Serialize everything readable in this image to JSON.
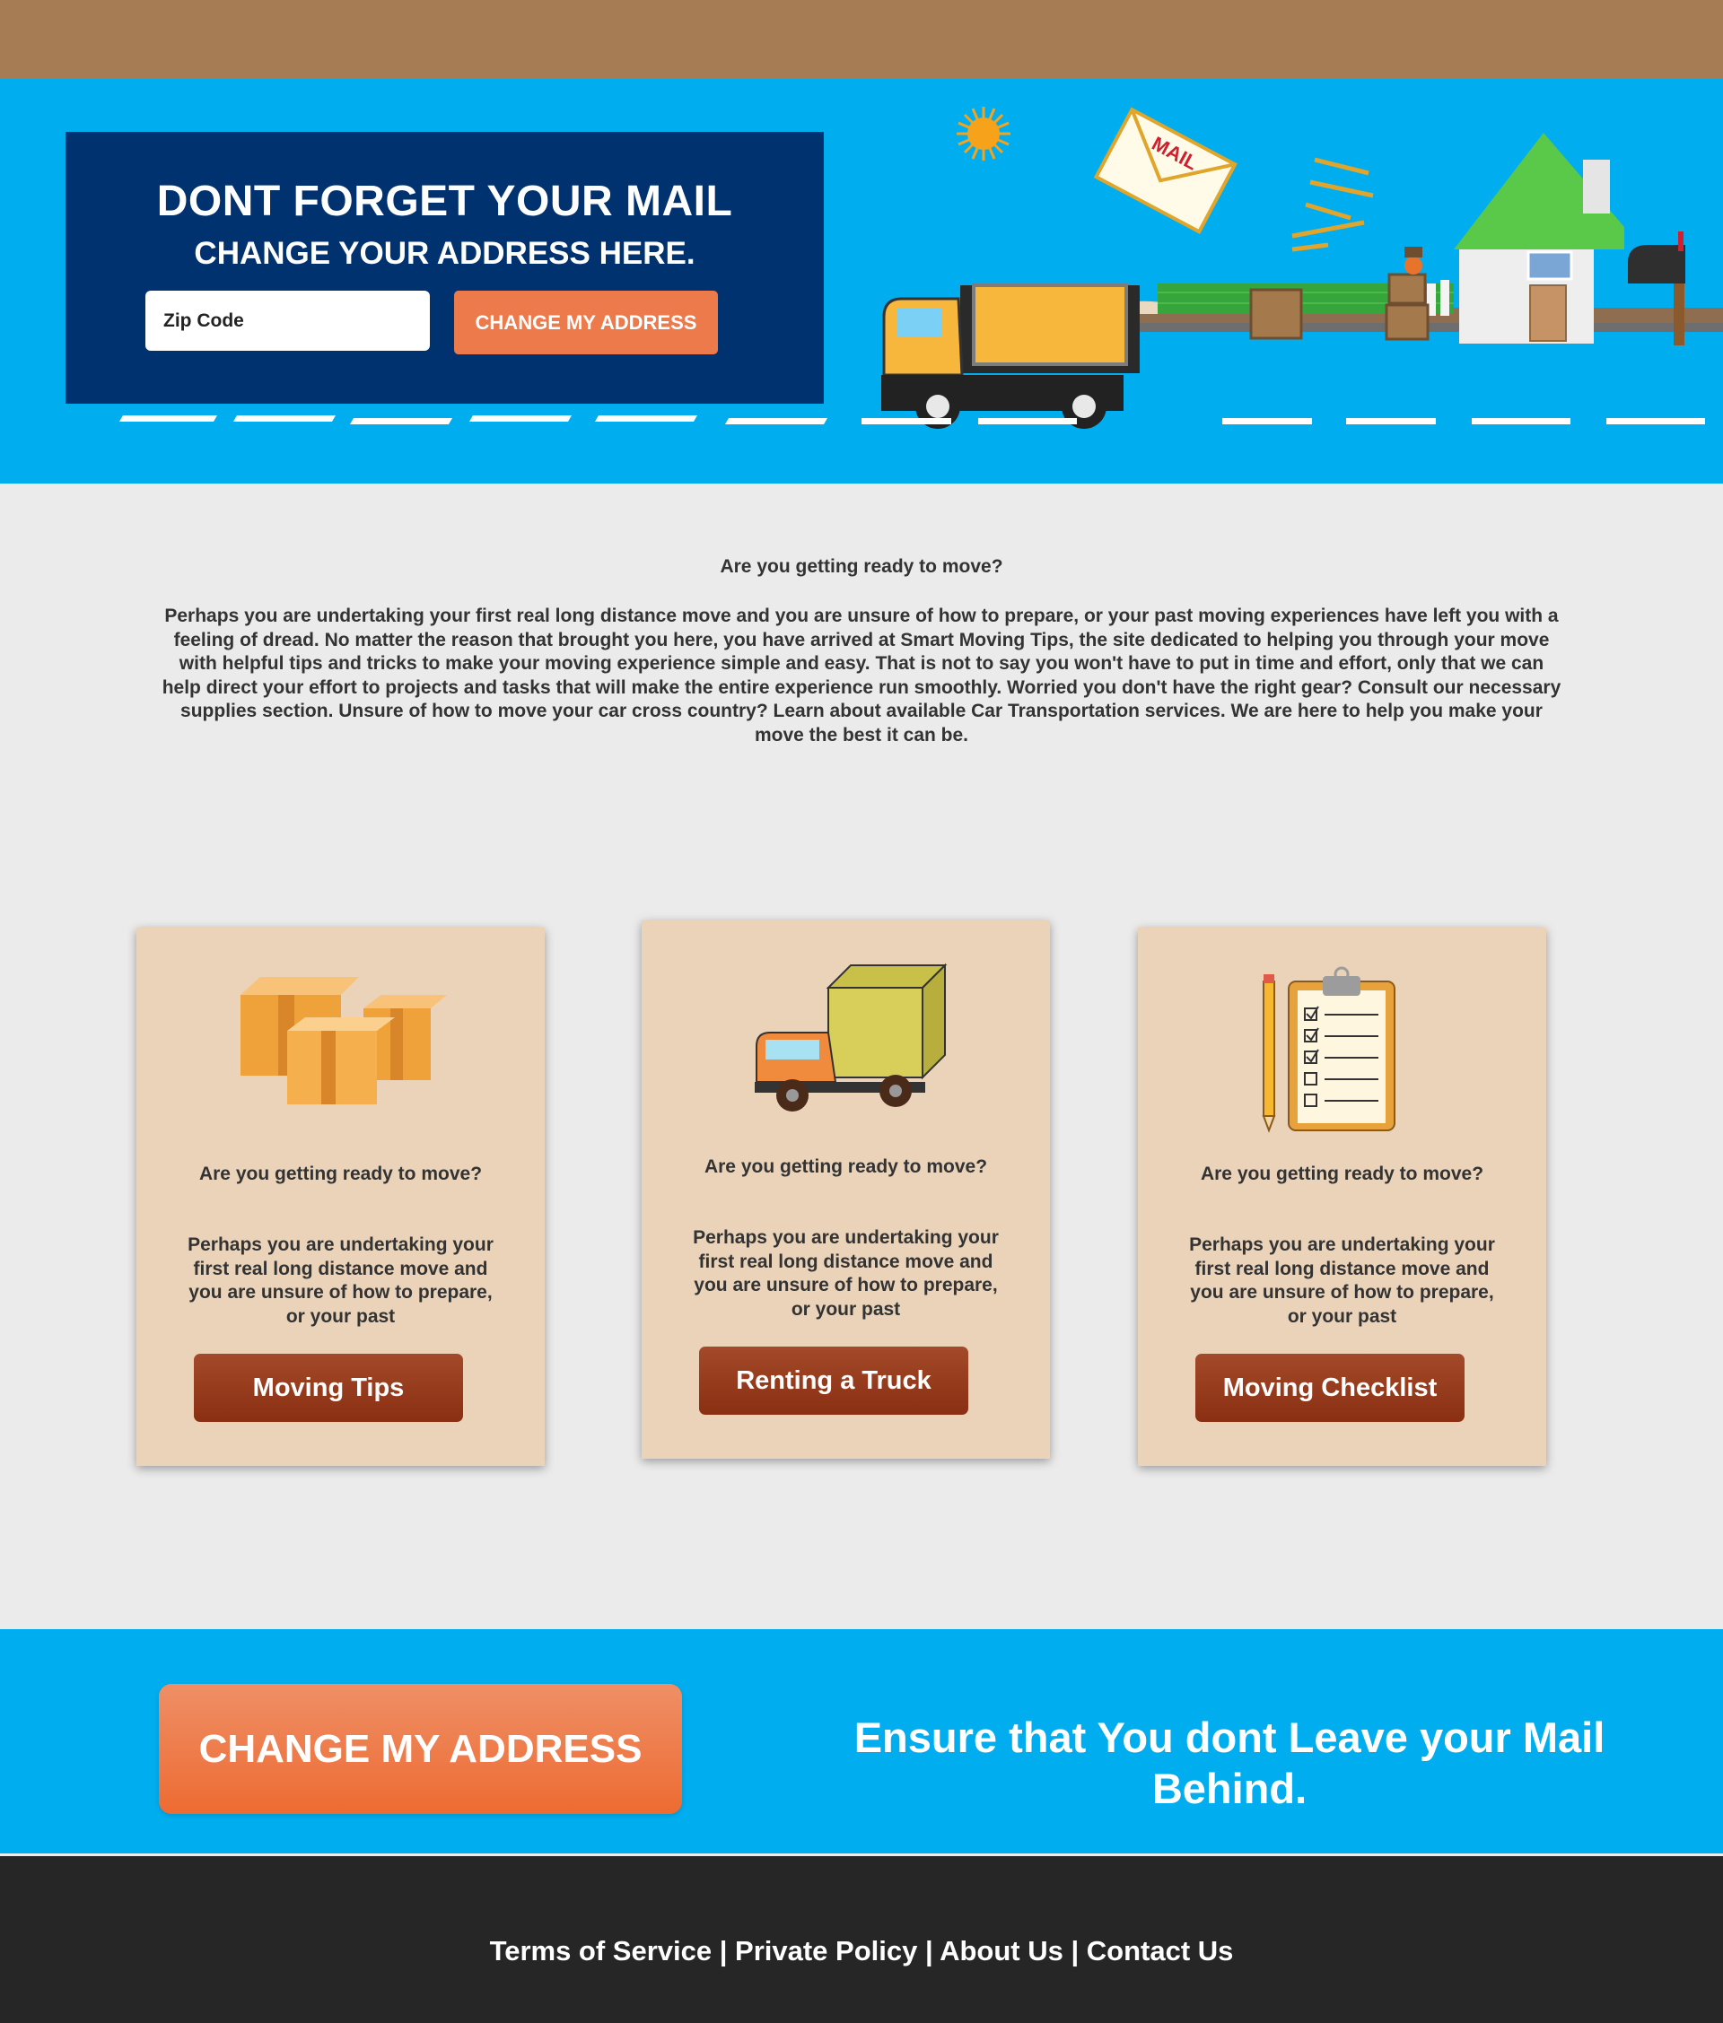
{
  "hero": {
    "title": "DONT FORGET YOUR MAIL",
    "subtitle": "CHANGE YOUR ADDRESS HERE.",
    "zip_placeholder": "Zip Code",
    "button_label": "CHANGE MY ADDRESS",
    "envelope_label": "MAIL"
  },
  "intro": {
    "heading": "Are you getting ready to move?",
    "body": "Perhaps you are undertaking your first real long distance move and you are unsure of how to prepare, or your past moving experiences have left you with a feeling of dread.  No matter the reason that brought you here, you have arrived at Smart Moving Tips, the site dedicated to helping you through your move with helpful tips and tricks to make your moving experience simple and easy.  That is not to say you won't have to put in time and effort, only that we can help direct your effort to projects and tasks that will make the entire experience run smoothly.  Worried you don't have the right gear? Consult our necessary supplies section.  Unsure of how to move your car cross country?  Learn about available Car Transportation services.  We are here to help you make your move the best it can be."
  },
  "cards": [
    {
      "icon": "boxes-icon",
      "heading": "Are you getting ready to move?",
      "body": "Perhaps you are undertaking your first real long distance move and you are unsure of how to prepare, or your past",
      "button": "Moving Tips"
    },
    {
      "icon": "truck-icon",
      "heading": "Are you getting ready to move?",
      "body": "Perhaps you are undertaking your first real long distance move and you are unsure of how to prepare, or your past",
      "button": "Renting a Truck"
    },
    {
      "icon": "checklist-icon",
      "heading": "Are you getting ready to move?",
      "body": "Perhaps you are undertaking your first real long distance move and you are unsure of how to prepare, or your past",
      "button": "Moving Checklist"
    }
  ],
  "cta": {
    "button": "CHANGE MY ADDRESS",
    "text": "Ensure that You dont Leave your Mail Behind."
  },
  "footer": {
    "links": [
      "Terms of Service",
      "Private Policy",
      "About Us",
      "Contact Us"
    ],
    "separator": " | "
  },
  "colors": {
    "topbar": "#a57c53",
    "hero_bg": "#00aeef",
    "hero_box": "#003270",
    "accent_orange": "#ed7a4b",
    "card_bg": "#ead3b9",
    "card_button": "#8f3416",
    "footer_bg": "#262626"
  }
}
